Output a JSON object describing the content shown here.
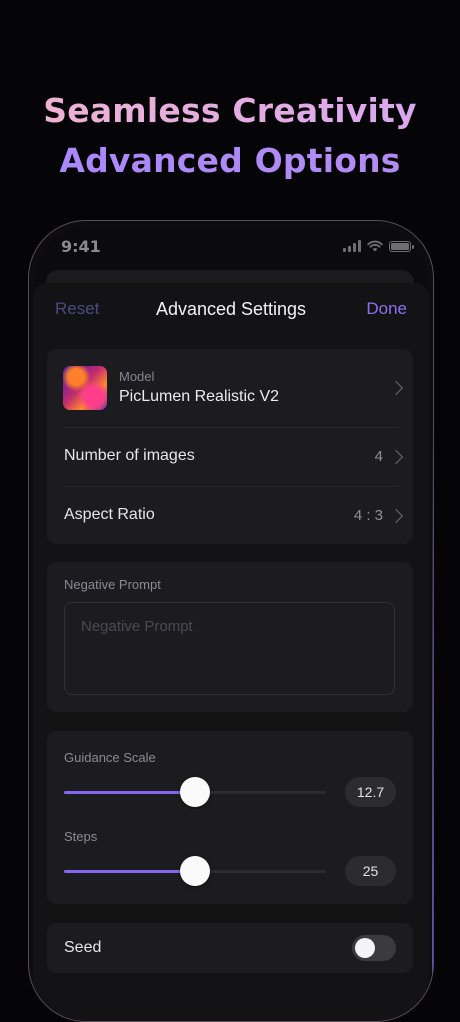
{
  "hero": {
    "line1": "Seamless Creativity",
    "line2": "Advanced Options"
  },
  "statusbar": {
    "time": "9:41"
  },
  "nav": {
    "reset": "Reset",
    "title": "Advanced Settings",
    "done": "Done"
  },
  "model": {
    "label": "Model",
    "value": "PicLumen Realistic V2"
  },
  "num_images": {
    "label": "Number of images",
    "value": "4"
  },
  "aspect_ratio": {
    "label": "Aspect Ratio",
    "value": "4 : 3"
  },
  "negative_prompt": {
    "label": "Negative Prompt",
    "placeholder": "Negative Prompt",
    "value": ""
  },
  "guidance": {
    "label": "Guidance Scale",
    "value": "12.7",
    "fraction": 0.5
  },
  "steps": {
    "label": "Steps",
    "value": "25",
    "fraction": 0.5
  },
  "seed": {
    "label": "Seed",
    "enabled": false
  },
  "colors": {
    "accent": "#8566f0",
    "sheet": "#131316",
    "card": "#1c1c20",
    "reset": "#4d4a80"
  }
}
